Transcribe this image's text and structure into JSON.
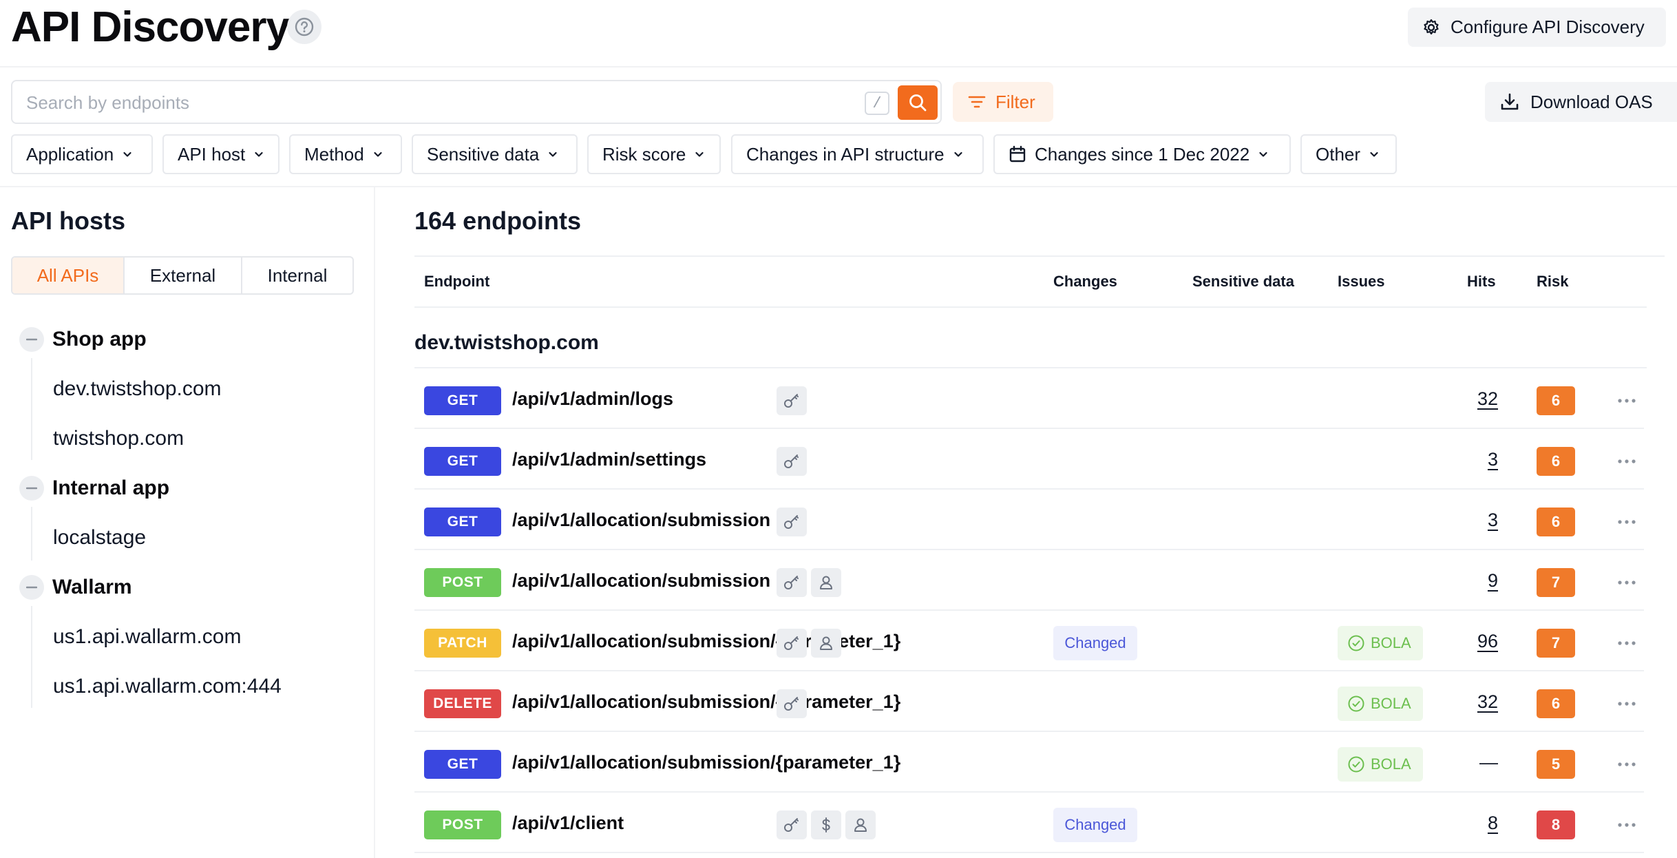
{
  "header": {
    "title": "API Discovery",
    "configure_label": "Configure API Discovery"
  },
  "search": {
    "placeholder": "Search by endpoints",
    "value": "",
    "shortcut": "/"
  },
  "toolbar": {
    "filter_label": "Filter",
    "download_label": "Download OAS"
  },
  "filters": [
    {
      "label": "Application"
    },
    {
      "label": "API host"
    },
    {
      "label": "Method"
    },
    {
      "label": "Sensitive data"
    },
    {
      "label": "Risk score"
    },
    {
      "label": "Changes in API structure"
    },
    {
      "label": "Changes since 1 Dec 2022"
    },
    {
      "label": "Other"
    }
  ],
  "sidebar": {
    "title": "API hosts",
    "segments": [
      "All APIs",
      "External",
      "Internal"
    ],
    "active_segment": "All APIs",
    "groups": [
      {
        "name": "Shop app",
        "hosts": [
          "dev.twistshop.com",
          "twistshop.com"
        ]
      },
      {
        "name": "Internal app",
        "hosts": [
          "localstage"
        ]
      },
      {
        "name": "Wallarm",
        "hosts": [
          "us1.api.wallarm.com",
          "us1.api.wallarm.com:444"
        ]
      }
    ]
  },
  "main": {
    "title": "164 endpoints",
    "columns": [
      "Endpoint",
      "Changes",
      "Sensitive data",
      "Issues",
      "Hits",
      "Risk"
    ],
    "group_host": "dev.twistshop.com",
    "rows": [
      {
        "method": "GET",
        "path": "/api/v1/admin/logs",
        "changes": "",
        "sensitive": [
          "key"
        ],
        "issue": "",
        "hits": "32",
        "risk": "6"
      },
      {
        "method": "GET",
        "path": "/api/v1/admin/settings",
        "changes": "",
        "sensitive": [
          "key"
        ],
        "issue": "",
        "hits": "3",
        "risk": "6"
      },
      {
        "method": "GET",
        "path": "/api/v1/allocation/submission",
        "changes": "",
        "sensitive": [
          "key"
        ],
        "issue": "",
        "hits": "3",
        "risk": "6"
      },
      {
        "method": "POST",
        "path": "/api/v1/allocation/submission",
        "changes": "",
        "sensitive": [
          "key",
          "user"
        ],
        "issue": "",
        "hits": "9",
        "risk": "7"
      },
      {
        "method": "PATCH",
        "path": "/api/v1/allocation/submission/{parameter_1}",
        "changes": "Changed",
        "sensitive": [
          "key",
          "user"
        ],
        "issue": "BOLA",
        "hits": "96",
        "risk": "7"
      },
      {
        "method": "DELETE",
        "path": "/api/v1/allocation/submission/{parameter_1}",
        "changes": "",
        "sensitive": [
          "key"
        ],
        "issue": "BOLA",
        "hits": "32",
        "risk": "6"
      },
      {
        "method": "GET",
        "path": "/api/v1/allocation/submission/{parameter_1}",
        "changes": "",
        "sensitive": [],
        "issue": "BOLA",
        "hits": "—",
        "risk": "5"
      },
      {
        "method": "POST",
        "path": "/api/v1/client",
        "changes": "Changed",
        "sensitive": [
          "key",
          "dollar",
          "user"
        ],
        "issue": "",
        "hits": "8",
        "risk": "8"
      }
    ]
  },
  "colors": {
    "accent": "#f26b1d",
    "GET": "#3a47e0",
    "POST": "#6ecb5a",
    "PATCH": "#f5c038",
    "DELETE": "#e04848",
    "risk_5": "#f07a2a",
    "risk_6": "#f07a2a",
    "risk_7": "#f07a2a",
    "risk_8": "#e04848"
  }
}
